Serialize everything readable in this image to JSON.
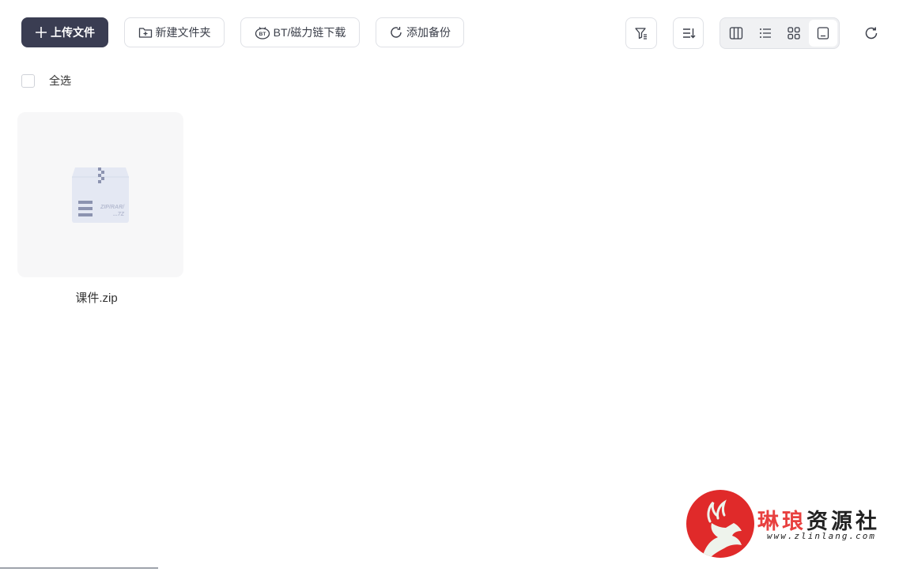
{
  "toolbar": {
    "upload_label": "上传文件",
    "new_folder_label": "新建文件夹",
    "bt_label": "BT/磁力链下载",
    "backup_label": "添加备份"
  },
  "selection": {
    "select_all_label": "全选"
  },
  "files": [
    {
      "name": "课件.zip",
      "thumb_text_1": "ZIP/RAR/",
      "thumb_text_2": "...7Z"
    }
  ],
  "watermark": {
    "title_part1": "琳琅",
    "title_part2": "资源社",
    "url": "www.zlinlang.com"
  },
  "colors": {
    "primary": "#3a3d52",
    "watermark_red": "#e02a2a"
  }
}
